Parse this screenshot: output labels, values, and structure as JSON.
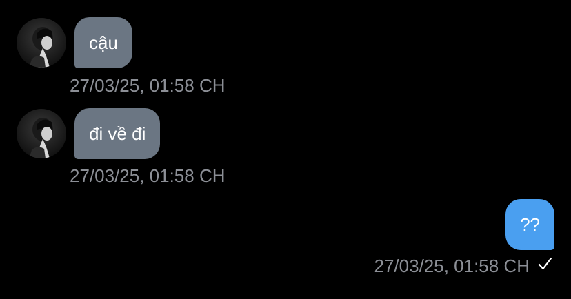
{
  "messages": [
    {
      "direction": "incoming",
      "text": "cậu",
      "timestamp": "27/03/25, 01:58 CH"
    },
    {
      "direction": "incoming",
      "text": "đi về đi",
      "timestamp": "27/03/25, 01:58 CH"
    },
    {
      "direction": "outgoing",
      "text": "??",
      "timestamp": "27/03/25, 01:58 CH",
      "status_icon": "check-icon"
    }
  ],
  "colors": {
    "background": "#000000",
    "incoming_bubble": "#6b7683",
    "outgoing_bubble": "#4a9ff0",
    "timestamp": "#8c8f96"
  }
}
